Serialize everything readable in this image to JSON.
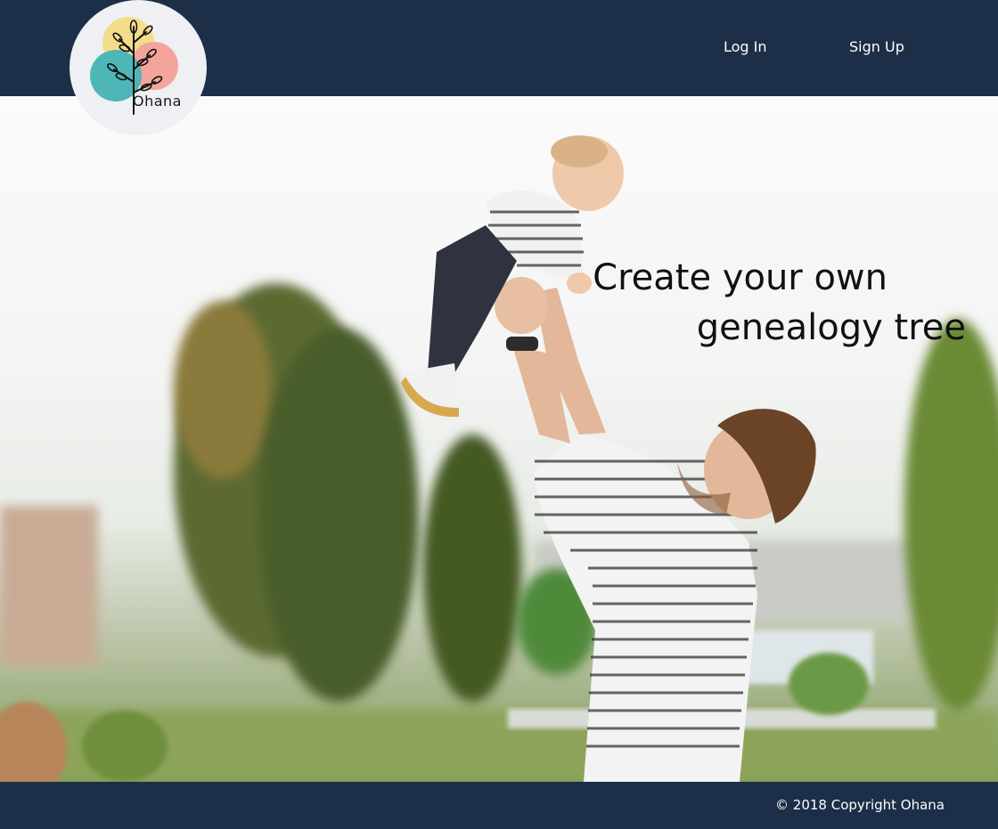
{
  "brand": {
    "name": "Ohana"
  },
  "nav": {
    "login_label": "Log In",
    "signup_label": "Sign Up"
  },
  "hero": {
    "headline_line1": "Create your own",
    "headline_line2": "genealogy tree"
  },
  "footer": {
    "copyright": "© 2018 Copyright Ohana"
  },
  "colors": {
    "header_bg": "#1c2e48",
    "footer_bg": "#1c2e48",
    "logo_bg": "#eef0f3",
    "logo_yellow": "#f3dd8a",
    "logo_teal": "#4fb6b7",
    "logo_pink": "#f3a49b"
  },
  "icons": {
    "logo": "tree-logo-icon"
  }
}
